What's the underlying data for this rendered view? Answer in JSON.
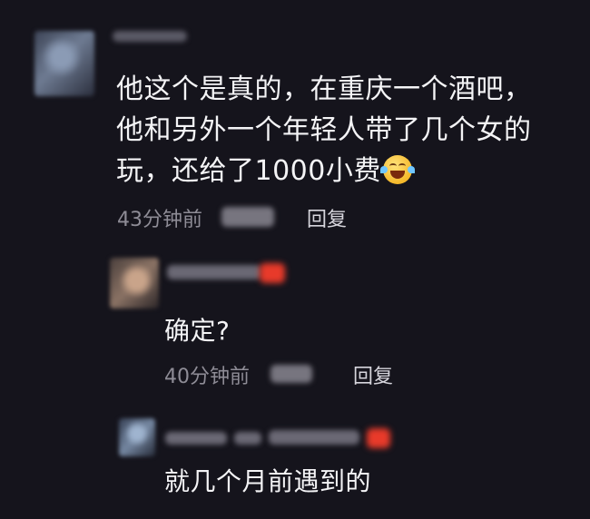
{
  "comments": [
    {
      "text_lines": [
        "他这个是真的，在重庆一个酒吧，",
        "他和另外一个年轻人带了几个女的",
        "玩，还给了1000小费"
      ],
      "emoji": "face-with-tears-of-joy-icon",
      "time": "43分钟前",
      "reply_label": "回复"
    },
    {
      "text": "确定?",
      "time": "40分钟前",
      "reply_label": "回复"
    },
    {
      "text": "就几个月前遇到的"
    }
  ],
  "colors": {
    "background": "#15141c",
    "text": "#f4f4f6",
    "meta": "#8e8c96",
    "badge": "#e83a2a"
  }
}
